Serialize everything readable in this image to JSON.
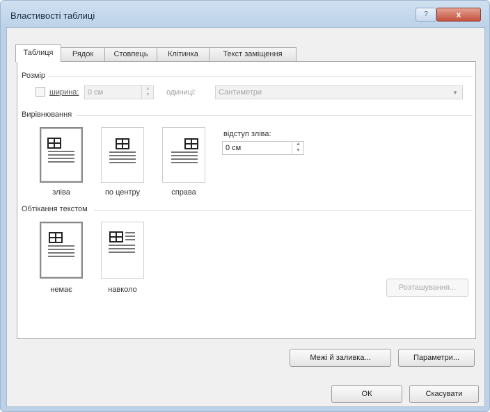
{
  "window": {
    "title": "Властивості таблиці",
    "help_glyph": "?",
    "close_glyph": "x"
  },
  "tabs": [
    {
      "label": "Таблиця",
      "active": true
    },
    {
      "label": "Рядок",
      "active": false
    },
    {
      "label": "Стовпець",
      "active": false
    },
    {
      "label": "Клітинка",
      "active": false
    },
    {
      "label": "Текст заміщення",
      "active": false
    }
  ],
  "size": {
    "section": "Розмір",
    "width_label": "ширина:",
    "width_checked": false,
    "width_value": "0 см",
    "units_label": "одиниці:",
    "units_value": "Сантиметри"
  },
  "alignment": {
    "section": "Вирівнювання",
    "options": [
      {
        "label": "зліва",
        "selected": true
      },
      {
        "label": "по центру",
        "selected": false
      },
      {
        "label": "справа",
        "selected": false
      }
    ],
    "indent_label": "відступ зліва:",
    "indent_value": "0 см"
  },
  "wrapping": {
    "section": "Обтікання текстом",
    "options": [
      {
        "label": "немає",
        "selected": true
      },
      {
        "label": "навколо",
        "selected": false
      }
    ],
    "positioning_button": "Розташування..."
  },
  "buttons": {
    "borders": "Межі й заливка...",
    "options": "Параметри...",
    "ok": "ОК",
    "cancel": "Скасувати"
  },
  "colors": {
    "title_bar": "#bcd1e8",
    "close_button": "#c4503d",
    "dialog_bg": "#f0f0f0"
  }
}
